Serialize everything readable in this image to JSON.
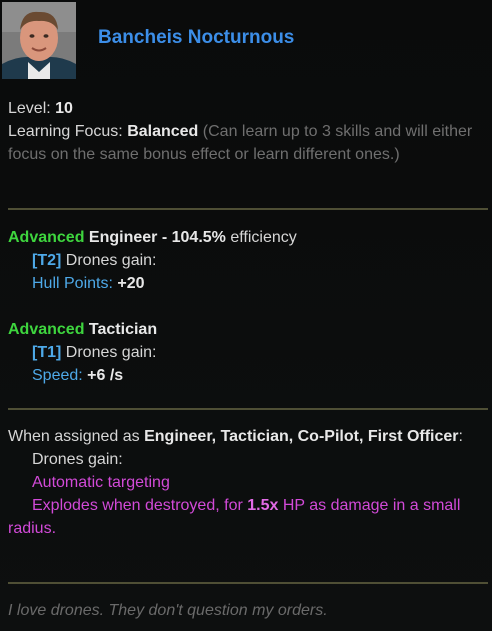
{
  "character": {
    "name": "Bancheis Nocturnous",
    "portrait_icon": "officer-portrait"
  },
  "stats": {
    "level_label": "Level:",
    "level_value": "10",
    "focus_label": "Learning Focus:",
    "focus_value": "Balanced",
    "focus_desc": "(Can learn up to 3 skills and will either focus on the same bonus effect or learn different ones.)"
  },
  "skills": [
    {
      "rank": "Advanced",
      "name": "Engineer",
      "efficiency": "- 104.5%",
      "efficiency_suffix": "efficiency",
      "tier": "[T2]",
      "gain_label": "Drones gain:",
      "stat_label": "Hull Points:",
      "stat_value": "+20"
    },
    {
      "rank": "Advanced",
      "name": "Tactician",
      "tier": "[T1]",
      "gain_label": "Drones gain:",
      "stat_label": "Speed:",
      "stat_value": "+6 /s"
    }
  ],
  "assignment": {
    "intro": "When assigned as",
    "roles": "Engineer, Tactician, Co-Pilot, First Officer",
    "colon": ":",
    "gain_label": "Drones gain:",
    "effect1": "Automatic targeting",
    "effect2_pre": "Explodes when destroyed, for",
    "effect2_mult": "1.5x",
    "effect2_post": "HP as damage in a small radius."
  },
  "flavor_text": "I love drones. They don't question my orders.",
  "colors": {
    "name": "#3c8ee8",
    "rank": "#3ed53e",
    "tier": "#4ea9e8",
    "effect": "#d24ad8",
    "separator": "#4f4f35"
  }
}
